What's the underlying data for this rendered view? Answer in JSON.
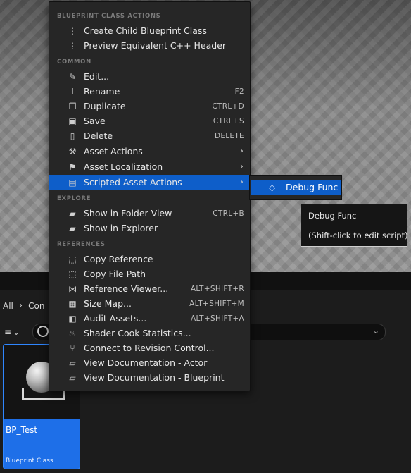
{
  "menu": {
    "sections": {
      "blueprint": "BLUEPRINT CLASS ACTIONS",
      "common": "COMMON",
      "explore": "EXPLORE",
      "references": "REFERENCES"
    },
    "items": [
      {
        "label": "Create Child Blueprint Class",
        "icon": "child-blueprint-icon",
        "shortcut": ""
      },
      {
        "label": "Preview Equivalent C++ Header",
        "icon": "cpp-header-icon",
        "shortcut": ""
      },
      {
        "label": "Edit...",
        "icon": "pencil-icon",
        "shortcut": ""
      },
      {
        "label": "Rename",
        "icon": "rename-icon",
        "shortcut": "F2"
      },
      {
        "label": "Duplicate",
        "icon": "duplicate-icon",
        "shortcut": "CTRL+D"
      },
      {
        "label": "Save",
        "icon": "save-icon",
        "shortcut": "CTRL+S"
      },
      {
        "label": "Delete",
        "icon": "trash-icon",
        "shortcut": "DELETE"
      },
      {
        "label": "Asset Actions",
        "icon": "wrench-icon",
        "shortcut": ""
      },
      {
        "label": "Asset Localization",
        "icon": "flag-icon",
        "shortcut": ""
      },
      {
        "label": "Scripted Asset Actions",
        "icon": "script-icon",
        "shortcut": ""
      },
      {
        "label": "Show in Folder View",
        "icon": "folder-view-icon",
        "shortcut": "CTRL+B"
      },
      {
        "label": "Show in Explorer",
        "icon": "explorer-icon",
        "shortcut": ""
      },
      {
        "label": "Copy Reference",
        "icon": "copy-reference-icon",
        "shortcut": ""
      },
      {
        "label": "Copy File Path",
        "icon": "copy-path-icon",
        "shortcut": ""
      },
      {
        "label": "Reference Viewer...",
        "icon": "reference-viewer-icon",
        "shortcut": "ALT+SHIFT+R"
      },
      {
        "label": "Size Map...",
        "icon": "size-map-icon",
        "shortcut": "ALT+SHIFT+M"
      },
      {
        "label": "Audit Assets...",
        "icon": "audit-icon",
        "shortcut": "ALT+SHIFT+A"
      },
      {
        "label": "Shader Cook Statistics...",
        "icon": "shader-icon",
        "shortcut": ""
      },
      {
        "label": "Connect to Revision Control...",
        "icon": "revision-control-icon",
        "shortcut": ""
      },
      {
        "label": "View Documentation - Actor",
        "icon": "documentation-icon",
        "shortcut": ""
      },
      {
        "label": "View Documentation - Blueprint",
        "icon": "documentation-icon",
        "shortcut": ""
      }
    ]
  },
  "submenu": {
    "item": "Debug Func",
    "icon": "function-icon"
  },
  "tooltip": {
    "title": "Debug Func",
    "hint": "(Shift-click to edit script)"
  },
  "browser": {
    "breadcrumb_root": "All",
    "breadcrumb_next": "Con",
    "asset": {
      "name": "BP_Test",
      "type": "Blueprint Class"
    }
  },
  "colors": {
    "highlight": "#0e5ec9",
    "tile": "#1e6fe8",
    "menu_bg": "#262626"
  }
}
